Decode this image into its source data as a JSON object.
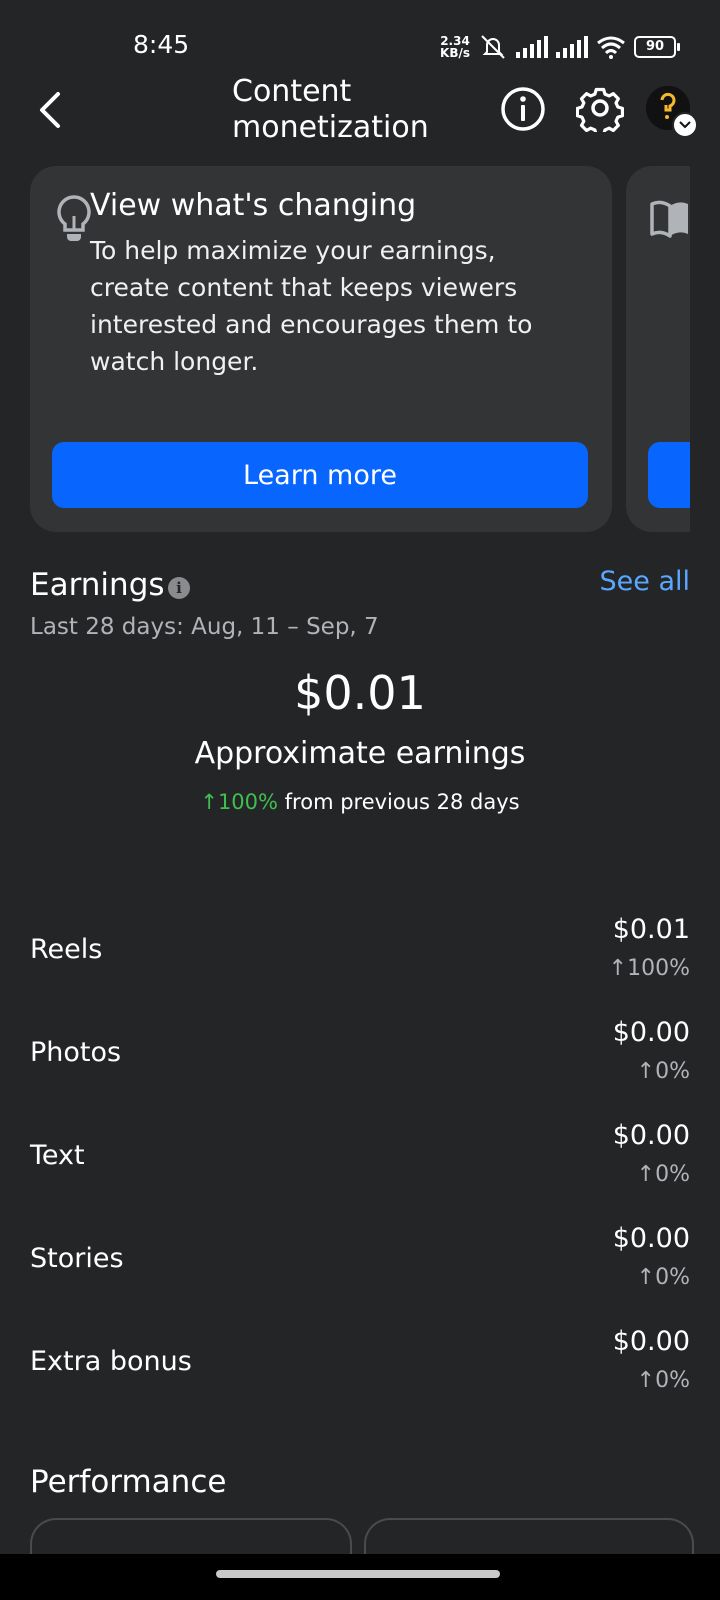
{
  "status_bar": {
    "time": "8:45",
    "net_speed": "2.34",
    "net_unit": "KB/s",
    "battery": "90",
    "icons": [
      "mute-icon",
      "signal-icon",
      "signal-icon",
      "wifi-icon",
      "battery-icon"
    ]
  },
  "header": {
    "title": "Content monetization",
    "back_icon": "chevron-left-icon",
    "info_icon": "info-icon",
    "settings_icon": "gear-icon"
  },
  "card": {
    "icon": "lightbulb-icon",
    "title": "View what's changing",
    "body": "To help maximize your earnings, create content that keeps viewers interested and encourages them to watch longer.",
    "button": "Learn more"
  },
  "card2": {
    "icon": "book-icon"
  },
  "earnings": {
    "title": "Earnings",
    "see_all": "See all",
    "date_range": "Last 28 days: Aug, 11 – Sep, 7",
    "total": "$0.01",
    "total_label": "Approximate earnings",
    "change_pct": "↑100%",
    "change_text": " from previous 28 days",
    "rows": [
      {
        "label": "Reels",
        "amount": "$0.01",
        "pct": "↑100%",
        "pct_color": "#3fbf4f"
      },
      {
        "label": "Photos",
        "amount": "$0.00",
        "pct": "↑0%",
        "pct_color": "#b0b3b8"
      },
      {
        "label": "Text",
        "amount": "$0.00",
        "pct": "↑0%",
        "pct_color": "#b0b3b8"
      },
      {
        "label": "Stories",
        "amount": "$0.00",
        "pct": "↑0%",
        "pct_color": "#b0b3b8"
      },
      {
        "label": "Extra bonus",
        "amount": "$0.00",
        "pct": "↑0%",
        "pct_color": "#b0b3b8"
      }
    ]
  },
  "performance": {
    "title": "Performance"
  },
  "colors": {
    "background": "#242527",
    "card": "#333436",
    "accent": "#0866ff",
    "link": "#5aa7ff",
    "positive": "#3fbf4f"
  }
}
